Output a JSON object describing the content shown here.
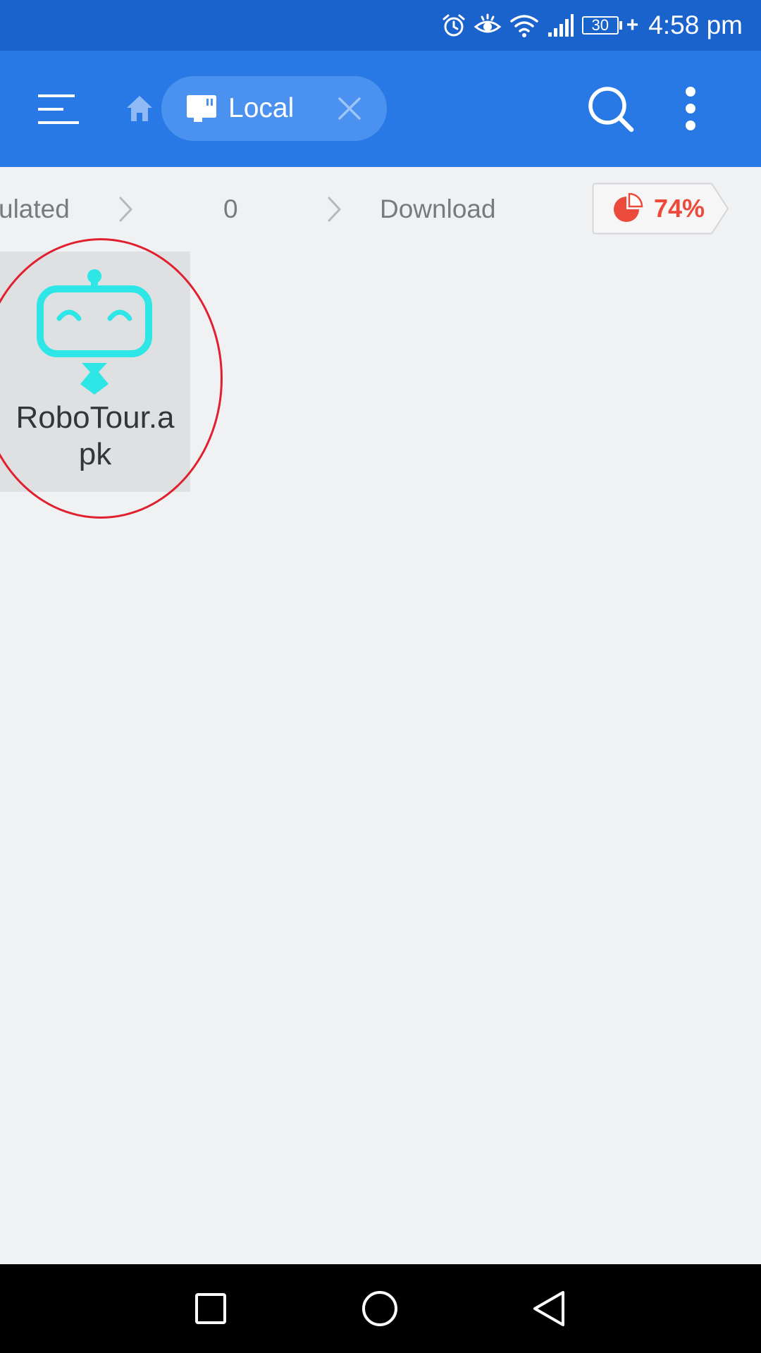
{
  "status_bar": {
    "battery_level": "30",
    "time": "4:58 pm",
    "icons": [
      "alarm-icon",
      "eye-comfort-icon",
      "wifi-icon",
      "signal-icon",
      "battery-icon",
      "charging-icon"
    ]
  },
  "toolbar": {
    "menu_icon": "hamburger-menu-icon",
    "home_icon": "home-icon",
    "tab_label": "Local",
    "tab_icon": "sd-card-icon",
    "close_icon": "close-icon",
    "search_icon": "search-icon",
    "more_icon": "more-vertical-icon"
  },
  "breadcrumb": {
    "items": [
      "ulated",
      "0",
      "Download"
    ],
    "storage_percent": "74%",
    "storage_used_fraction": 0.74
  },
  "files": [
    {
      "name": "RoboTour.apk",
      "icon": "robot-app-icon",
      "selected": true
    }
  ],
  "annotation": {
    "highlight": "red-ellipse"
  },
  "colors": {
    "status_bar": "#1b63cc",
    "toolbar": "#2879e6",
    "tab_bg": "#4b91ef",
    "background": "#f0f1f3",
    "tile_bg": "#dfe0e2",
    "accent_red": "#ec4b3c",
    "robot_cyan": "#2ee6e6",
    "nav_bar": "#000000"
  },
  "nav_bar": {
    "icons": [
      "recents-icon",
      "home-circle-icon",
      "back-icon"
    ]
  }
}
